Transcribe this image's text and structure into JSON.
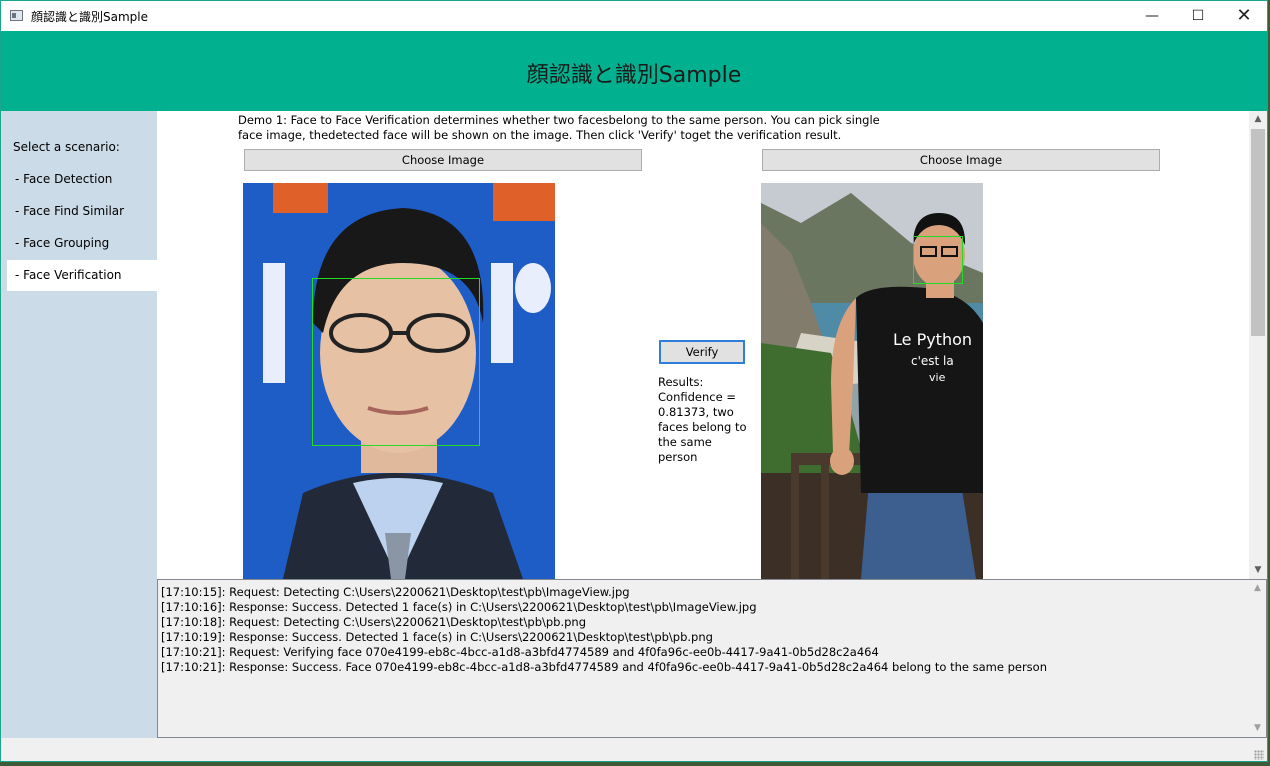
{
  "window": {
    "title": "顔認識と識別Sample",
    "controls": {
      "minimize": "—",
      "maximize": "☐",
      "close": "✕"
    }
  },
  "header": {
    "title": "顔認識と識別Sample"
  },
  "sidebar": {
    "heading": "Select a scenario:",
    "items": [
      {
        "label": "- Face Detection",
        "active": false
      },
      {
        "label": "- Face Find Similar",
        "active": false
      },
      {
        "label": "- Face Grouping",
        "active": false
      },
      {
        "label": "- Face Verification",
        "active": true
      }
    ]
  },
  "main": {
    "description": "Demo 1: Face to Face Verification determines whether two facesbelong to the same person. You can pick single face image, thedetected face will be shown on the image. Then click 'Verify' toget the verification result.",
    "left_panel": {
      "choose_label": "Choose Image"
    },
    "right_panel": {
      "choose_label": "Choose Image",
      "shirt_text": [
        "Le Python",
        "c'est la",
        "vie"
      ]
    },
    "verify_label": "Verify",
    "results_text": "Results: Confidence = 0.81373, two faces belong to the same person"
  },
  "scrollbar": {
    "up": "▲",
    "down": "▼"
  },
  "log": {
    "lines": [
      "[17:10:15]: Request: Detecting C:\\Users\\2200621\\Desktop\\test\\pb\\ImageView.jpg",
      "[17:10:16]: Response: Success. Detected 1 face(s) in C:\\Users\\2200621\\Desktop\\test\\pb\\ImageView.jpg",
      "[17:10:18]: Request: Detecting C:\\Users\\2200621\\Desktop\\test\\pb\\pb.png",
      "[17:10:19]: Response: Success. Detected 1 face(s) in C:\\Users\\2200621\\Desktop\\test\\pb\\pb.png",
      "[17:10:21]: Request: Verifying face 070e4199-eb8c-4bcc-a1d8-a3bfd4774589 and 4f0fa96c-ee0b-4417-9a41-0b5d28c2a464",
      "[17:10:21]: Response: Success. Face 070e4199-eb8c-4bcc-a1d8-a3bfd4774589 and 4f0fa96c-ee0b-4417-9a41-0b5d28c2a464 belong to the same person"
    ]
  }
}
